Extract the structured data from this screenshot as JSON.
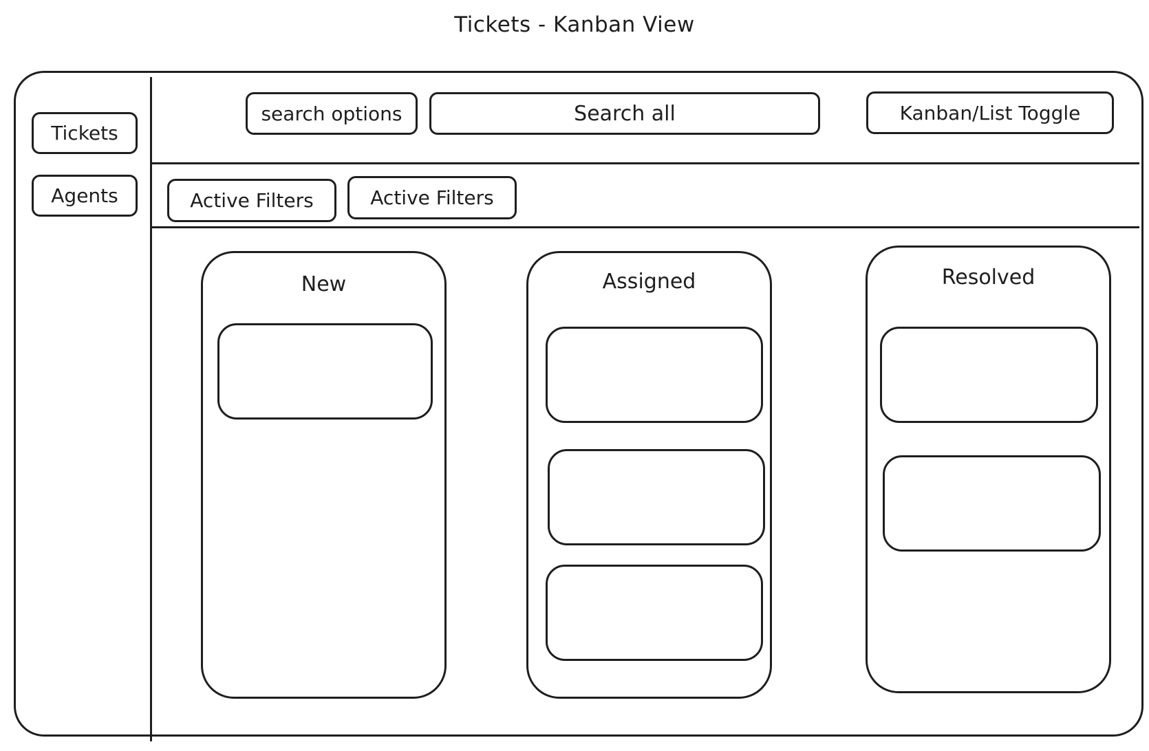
{
  "page": {
    "title": "Tickets - Kanban View"
  },
  "sidebar": {
    "items": [
      {
        "label": "Tickets"
      },
      {
        "label": "Agents"
      }
    ]
  },
  "toolbar": {
    "search_options_label": "search options",
    "search_placeholder": "Search all",
    "view_toggle_label": "Kanban/List Toggle"
  },
  "filters": {
    "chips": [
      {
        "label": "Active Filters"
      },
      {
        "label": "Active Filters"
      }
    ]
  },
  "board": {
    "columns": [
      {
        "title": "New",
        "card_count": 1
      },
      {
        "title": "Assigned",
        "card_count": 3
      },
      {
        "title": "Resolved",
        "card_count": 2
      }
    ]
  }
}
